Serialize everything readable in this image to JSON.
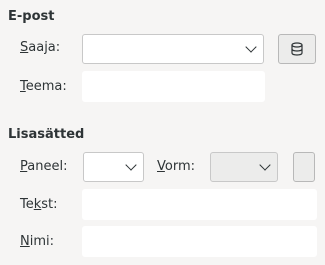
{
  "email": {
    "title": "E-post",
    "recipient": {
      "accel": "S",
      "rest": "aaja:",
      "value": ""
    },
    "subject": {
      "accel": "T",
      "rest": "eema:",
      "value": ""
    }
  },
  "advanced": {
    "title": "Lisasätted",
    "panel": {
      "accel": "P",
      "rest": "aneel:",
      "value": ""
    },
    "form": {
      "accel": "V",
      "rest": "orm:",
      "value": ""
    },
    "text": {
      "pre": "Te",
      "accel": "k",
      "rest": "st:",
      "value": ""
    },
    "name": {
      "accel": "N",
      "rest": "imi:",
      "value": ""
    }
  },
  "icons": {
    "address_book": "database-icon"
  }
}
